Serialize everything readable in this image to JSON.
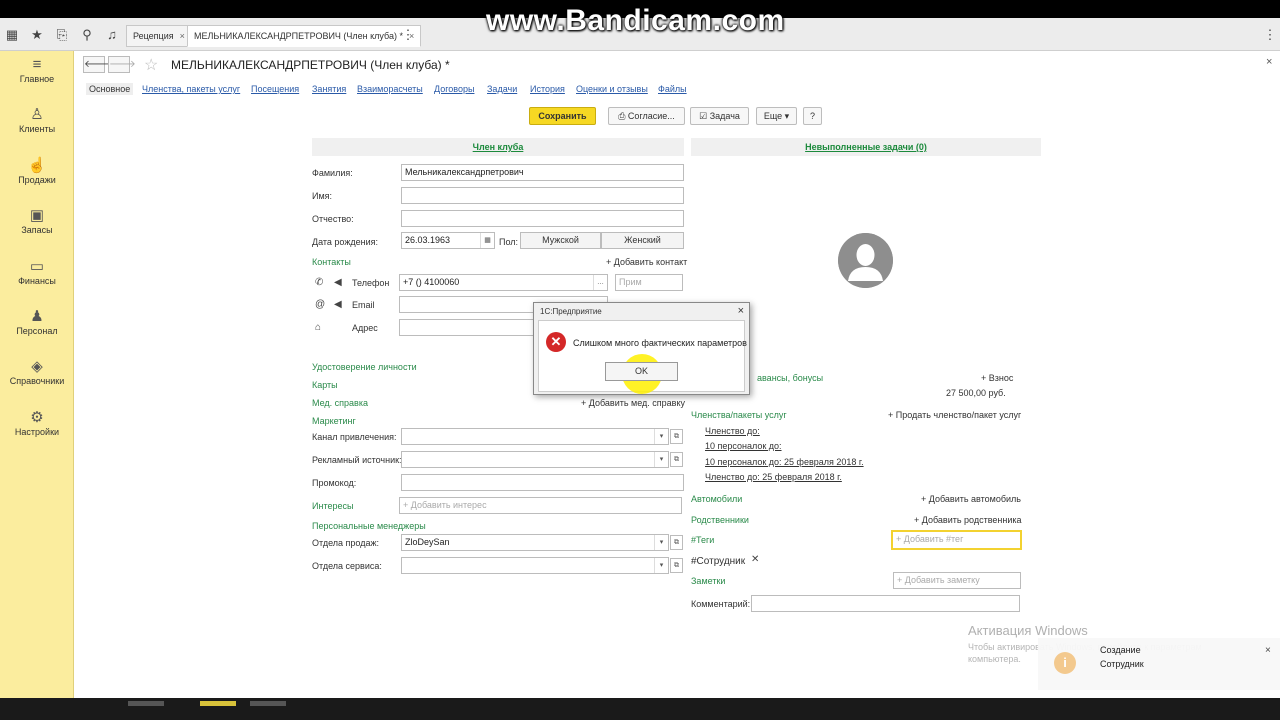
{
  "watermark": "www.Bandicam.com",
  "tabs": [
    {
      "label": "Рецепция"
    },
    {
      "label": "МЕЛЬНИКАЛЕКСАНДРПЕТРОВИЧ (Член клуба) *"
    }
  ],
  "sidebar": {
    "items": [
      {
        "label": "Главное",
        "icon": "menu-icon"
      },
      {
        "label": "Клиенты",
        "icon": "person-icon"
      },
      {
        "label": "Продажи",
        "icon": "sales-icon"
      },
      {
        "label": "Запасы",
        "icon": "box-icon"
      },
      {
        "label": "Финансы",
        "icon": "wallet-icon"
      },
      {
        "label": "Персонал",
        "icon": "staff-icon"
      },
      {
        "label": "Справочники",
        "icon": "stack-icon"
      },
      {
        "label": "Настройки",
        "icon": "gear-icon"
      }
    ]
  },
  "header": {
    "title": "МЕЛЬНИКАЛЕКСАНДРПЕТРОВИЧ (Член клуба) *"
  },
  "subtabs": [
    "Основное",
    "Членства, пакеты услуг",
    "Посещения",
    "Занятия",
    "Взаиморасчеты",
    "Договоры",
    "Задачи",
    "История",
    "Оценки и отзывы",
    "Файлы"
  ],
  "toolbar": {
    "save": "Сохранить",
    "consent": "Согласие...",
    "task": "Задача",
    "more": "Еще",
    "help": "?"
  },
  "left": {
    "head": "Член клуба",
    "surname_label": "Фамилия:",
    "surname_value": "Мельникалександрпетрович",
    "name_label": "Имя:",
    "patronymic_label": "Отчество:",
    "dob_label": "Дата рождения:",
    "dob_value": "26.03.1963",
    "sex_label": "Пол:",
    "male": "Мужской",
    "female": "Женский",
    "contacts": "Контакты",
    "add_contact": "+ Добавить контакт",
    "phone_label": "Телефон",
    "phone_value": "+7 () 4100060",
    "note_ph": "Прим",
    "email_label": "Email",
    "address_label": "Адрес",
    "id_doc": "Удостоверение личности",
    "cards": "Карты",
    "med": "Мед. справка",
    "add_med": "+ Добавить мед. справку",
    "marketing": "Маркетинг",
    "channel_label": "Канал привлечения:",
    "ad_label": "Рекламный источник:",
    "promo_label": "Промокод:",
    "interests": "Интересы",
    "add_interest_ph": "+ Добавить интерес",
    "managers": "Персональные менеджеры",
    "sales_label": "Отдела продаж:",
    "sales_value": "ZloDeySan",
    "service_label": "Отдела сервиса:"
  },
  "right": {
    "head": "Невыполненные задачи (0)",
    "bonuses": "авансы, бонусы",
    "fee": "+ Взнос",
    "amount": "27 500,00  руб.",
    "memberships": "Членства/пакеты услуг",
    "sell": "+ Продать членство/пакет услуг",
    "m1": "Членство до:",
    "m2": "10 персоналок до:",
    "m3": "10 персоналок до: 25 февраля 2018 г.",
    "m4": "Членство до: 25 февраля 2018 г.",
    "cars": "Автомобили",
    "add_car": "+ Добавить автомобиль",
    "relatives": "Родственники",
    "add_relative": "+ Добавить родственника",
    "tags": "#Теги",
    "add_tag_ph": "+ Добавить #тег",
    "tag_employee": "#Сотрудник",
    "notes": "Заметки",
    "add_note_ph": "+ Добавить заметку",
    "comment_label": "Комментарий:"
  },
  "dialog": {
    "title": "1С:Предприятие",
    "message": "Слишком много фактических параметров",
    "ok": "OK"
  },
  "windows": {
    "activation_title": "Активация Windows",
    "activation_text": "Чтобы активировать Windows, перейдите к параметрам компьютера.",
    "notif_title": "Создание",
    "notif_text": "Сотрудник"
  }
}
